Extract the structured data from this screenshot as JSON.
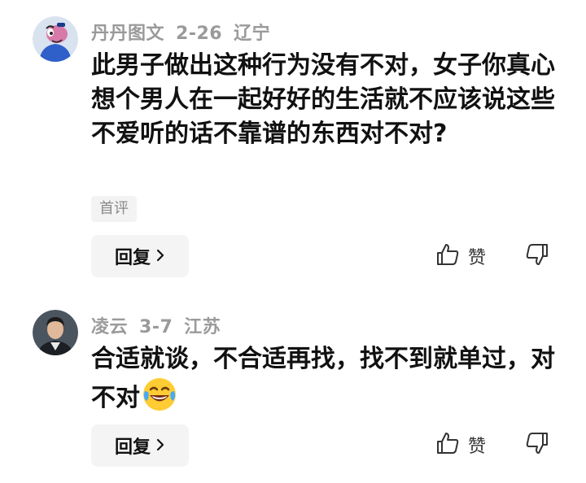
{
  "comments": [
    {
      "user": "丹丹图文",
      "date": "2-26",
      "location": "辽宁",
      "text": "此男子做出这种行为没有不对，女子你真心想个男人在一起好好的生活就不应该说这些不爱听的话不靠谱的东西对不对?",
      "tag": "首评",
      "reply_label": "回复",
      "like_label": "赞",
      "avatar_icon": "cartoon-character-avatar"
    },
    {
      "user": "凌云",
      "date": "3-7",
      "location": "江苏",
      "text": "合适就谈，不合适再找，找不到就单过，对不对",
      "emoji": "laughing-crying-emoji",
      "reply_label": "回复",
      "like_label": "赞",
      "avatar_icon": "man-in-suit-avatar"
    }
  ],
  "colors": {
    "meta": "#9a9a9a",
    "text": "#111111",
    "button_bg": "#f4f4f4",
    "tag_bg": "#f3f3f3"
  }
}
